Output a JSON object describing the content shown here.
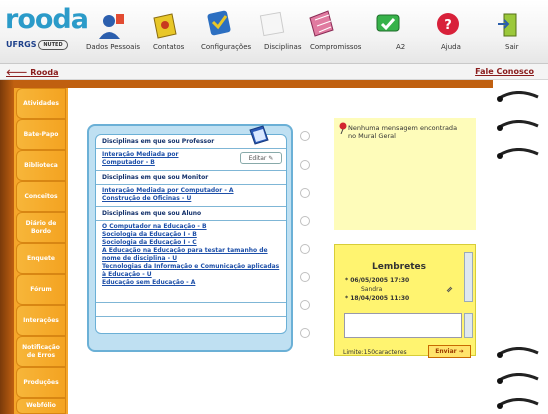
{
  "app": {
    "logo": "rooda",
    "logo_sub1": "UFRGS",
    "logo_sub2": "NUTED"
  },
  "nav": [
    {
      "label": "Dados Pessoais",
      "icon": "person-icon"
    },
    {
      "label": "Contatos",
      "icon": "contacts-icon"
    },
    {
      "label": "Configurações",
      "icon": "settings-icon"
    },
    {
      "label": "Disciplinas",
      "icon": "disciplines-icon"
    },
    {
      "label": "Compromissos",
      "icon": "calendar-icon"
    },
    {
      "label": "A2",
      "icon": "a2-icon"
    },
    {
      "label": "Ajuda",
      "icon": "help-icon"
    },
    {
      "label": "Sair",
      "icon": "exit-icon"
    }
  ],
  "subbar": {
    "back_label": "Rooda",
    "contact_label": "Fale Conosco"
  },
  "tabs": [
    "Atividades",
    "Bate-Papo",
    "Biblioteca",
    "Conceitos",
    "Diário de Bordo",
    "Enquete",
    "Fórum",
    "Interações",
    "Notificação de Erros",
    "Produções",
    "Webfólio"
  ],
  "disciplinas": {
    "professor_header": "Disciplinas em que sou Professor",
    "professor_items": [
      "Interação Mediada por Computador - B"
    ],
    "edit_label": "Editar",
    "monitor_header": "Disciplinas em que sou Monitor",
    "monitor_items": [
      "Interação Mediada por Computador - A",
      "Construção de Oficinas - U"
    ],
    "aluno_header": "Disciplinas em que sou Aluno",
    "aluno_items": [
      "O Computador na Educação - B",
      "Sociologia da Educação I - B",
      "Sociologia da Educação I - C",
      "A Educação na Educação para testar tamanho de nome de disciplina - U",
      "Tecnologias da Informação e Comunicação aplicadas à Educação - U",
      "Educação sem Educação - A"
    ]
  },
  "mural": {
    "message": "Nenhuma mensagem encontrada no Mural Geral"
  },
  "lembretes": {
    "title": "Lembretes",
    "items": [
      {
        "date": "06/05/2005 17:30",
        "sub": "Sandra"
      },
      {
        "date": "18/04/2005 11:30",
        "sub": ""
      }
    ],
    "limit_label": "Limite:150caracteres",
    "send_label": "Enviar"
  },
  "colors": {
    "orange": "#f4a321",
    "blue_card": "#bfe0f2",
    "sticky_yellow": "#fff470"
  }
}
